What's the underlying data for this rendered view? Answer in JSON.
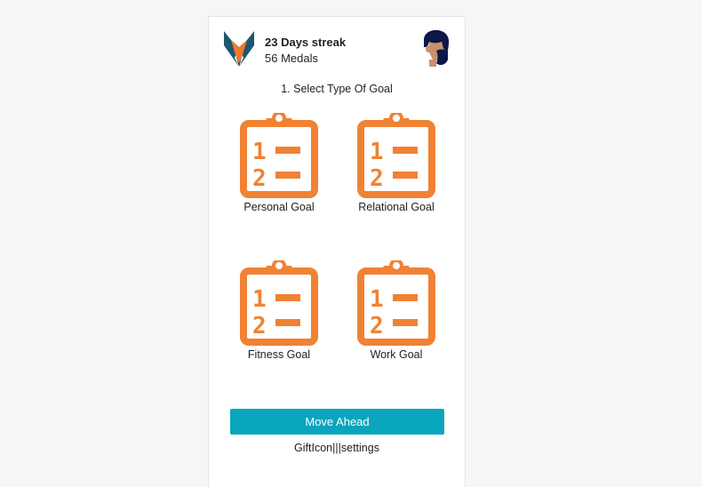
{
  "header": {
    "logo_icon": "fox-logo-icon",
    "streak_text": "23 Days streak",
    "medals_text": "56 Medals",
    "avatar_icon": "bearded-man-avatar-icon"
  },
  "step_title": "1. Select Type Of Goal",
  "goals": [
    {
      "label": "Personal Goal",
      "icon": "clipboard-list-icon"
    },
    {
      "label": "Relational Goal",
      "icon": "clipboard-list-icon"
    },
    {
      "label": "Fitness Goal",
      "icon": "clipboard-list-icon"
    },
    {
      "label": "Work Goal",
      "icon": "clipboard-list-icon"
    }
  ],
  "move_button_label": "Move Ahead",
  "footer_text": "GiftIcon|||settings",
  "colors": {
    "accent": "#09a5bd",
    "icon_orange": "#f08234",
    "logo_orange": "#f07a2a",
    "logo_teal": "#1f5770",
    "avatar_hair": "#0d1748",
    "avatar_skin": "#c8916a"
  }
}
